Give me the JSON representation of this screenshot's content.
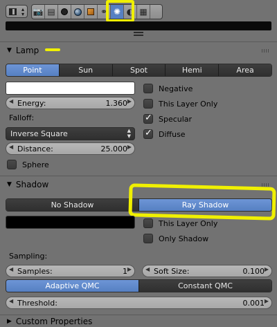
{
  "context_tabs": [
    "render-icon",
    "scene-icon",
    "world-icon",
    "object-icon",
    "constraints-icon",
    "modifiers-icon",
    "data-lamp-icon",
    "material-icon",
    "texture-icon"
  ],
  "lamp_panel": {
    "title": "Lamp",
    "types": [
      "Point",
      "Sun",
      "Spot",
      "Hemi",
      "Area"
    ],
    "active_type": "Point",
    "color": "#ffffff",
    "energy_label": "Energy:",
    "energy_value": "1.360",
    "falloff_label": "Falloff:",
    "falloff_value": "Inverse Square",
    "distance_label": "Distance:",
    "distance_value": "25.000",
    "sphere_label": "Sphere",
    "sphere_checked": false,
    "negative_label": "Negative",
    "negative_checked": false,
    "this_layer_label": "This Layer Only",
    "this_layer_checked": false,
    "specular_label": "Specular",
    "specular_checked": true,
    "diffuse_label": "Diffuse",
    "diffuse_checked": true
  },
  "shadow_panel": {
    "title": "Shadow",
    "modes": [
      "No Shadow",
      "Ray Shadow"
    ],
    "active_mode": "Ray Shadow",
    "color": "#000000",
    "this_layer_label": "This Layer Only",
    "this_layer_checked": false,
    "only_shadow_label": "Only Shadow",
    "only_shadow_checked": false,
    "sampling_label": "Sampling:",
    "samples_label": "Samples:",
    "samples_value": "1",
    "soft_size_label": "Soft Size:",
    "soft_size_value": "0.100",
    "qmc_modes": [
      "Adaptive QMC",
      "Constant QMC"
    ],
    "active_qmc": "Adaptive QMC",
    "threshold_label": "Threshold:",
    "threshold_value": "0.001"
  },
  "custom_properties": {
    "title": "Custom Properties"
  },
  "colors": {
    "active_blue": "#5680c2",
    "highlight_yellow": "#f0f000"
  }
}
